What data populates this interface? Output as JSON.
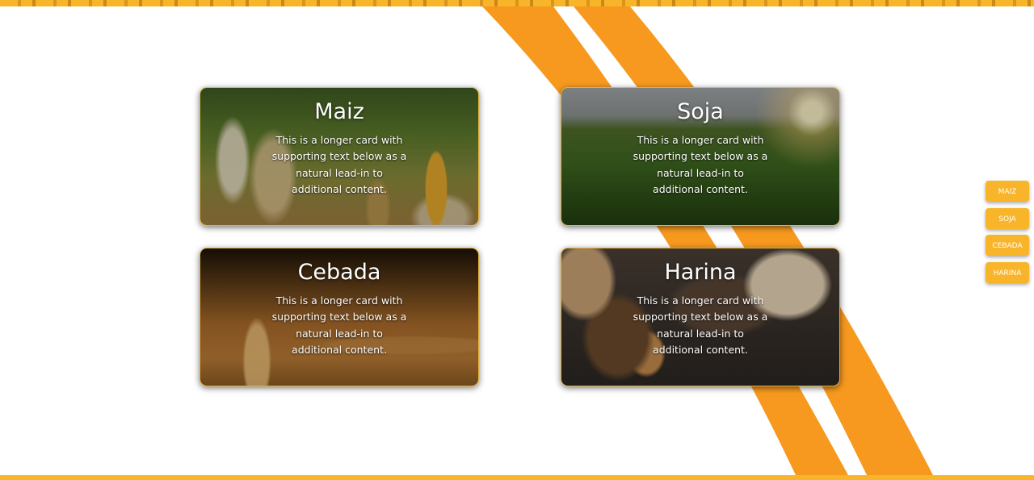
{
  "colors": {
    "accent": "#f8b52a",
    "stripe": "#f7991f"
  },
  "cards": [
    {
      "title": "Maiz",
      "text": "This is a longer card with supporting text below as a natural lead-in to additional content."
    },
    {
      "title": "Soja",
      "text": "This is a longer card with supporting text below as a natural lead-in to additional content."
    },
    {
      "title": "Cebada",
      "text": "This is a longer card with supporting text below as a natural lead-in to additional content."
    },
    {
      "title": "Harina",
      "text": "This is a longer card with supporting text below as a natural lead-in to additional content."
    }
  ],
  "side_nav": [
    "MAIZ",
    "SOJA",
    "CEBADA",
    "HARINA"
  ]
}
